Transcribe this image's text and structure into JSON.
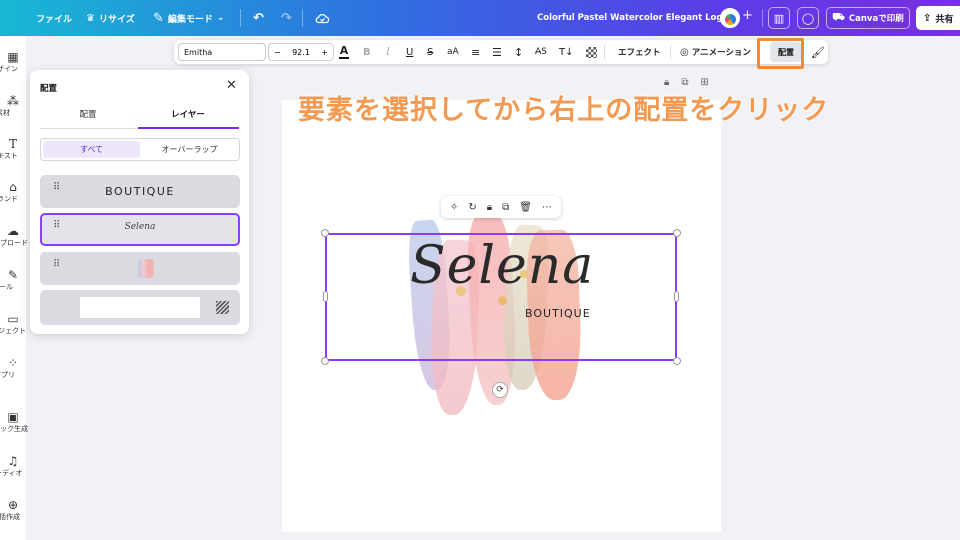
{
  "topbar": {
    "file_label": "ファイル",
    "resize_label": "リサイズ",
    "edit_mode_label": "編集モード",
    "doc_title": "Colorful Pastel Watercolor Elegant Logo",
    "print_label": "Canvaで印刷",
    "share_label": "共有",
    "undo_icon": "undo-icon",
    "redo_icon": "redo-icon",
    "cloud_icon": "cloud-saved-icon"
  },
  "rail": {
    "items": [
      {
        "label": "デザイン",
        "icon": "design-icon"
      },
      {
        "label": "素材",
        "icon": "elements-icon"
      },
      {
        "label": "テキスト",
        "icon": "text-icon"
      },
      {
        "label": "ブランド",
        "icon": "brand-icon"
      },
      {
        "label": "アップロード",
        "icon": "upload-icon"
      },
      {
        "label": "ツール",
        "icon": "draw-icon"
      },
      {
        "label": "プロジェクト",
        "icon": "folder-icon"
      },
      {
        "label": "アプリ",
        "icon": "apps-icon"
      },
      {
        "label": "マジック生成",
        "icon": "magic-media-icon"
      },
      {
        "label": "オーディオ",
        "icon": "audio-icon"
      },
      {
        "label": "一括作成",
        "icon": "bulk-create-icon"
      }
    ]
  },
  "toolbar": {
    "font_name": "Emitha",
    "font_size": "92.1",
    "minus": "−",
    "plus": "+",
    "effect_label": "エフェクト",
    "animation_label": "アニメーション",
    "arrange_label": "配置"
  },
  "annotation": {
    "text": "要素を選択してから右上の配置をクリック"
  },
  "panel": {
    "title": "配置",
    "tabs": [
      {
        "label": "配置",
        "active": false
      },
      {
        "label": "レイヤー",
        "active": true
      }
    ],
    "segments": [
      {
        "label": "すべて",
        "active": true
      },
      {
        "label": "オーバーラップ",
        "active": false
      }
    ],
    "layers": [
      {
        "label": "BOUTIQUE",
        "selected": false
      },
      {
        "label": "Selena",
        "selected": true
      },
      {
        "label": "",
        "selected": false
      },
      {
        "label": "",
        "selected": false
      }
    ]
  },
  "canvas": {
    "script_text": "Selena",
    "boutique_text": "BOUTIQUE"
  },
  "colors": {
    "accent": "#8b3dff",
    "annotation": "#f39a52",
    "highlight_box": "#f08a3c"
  }
}
